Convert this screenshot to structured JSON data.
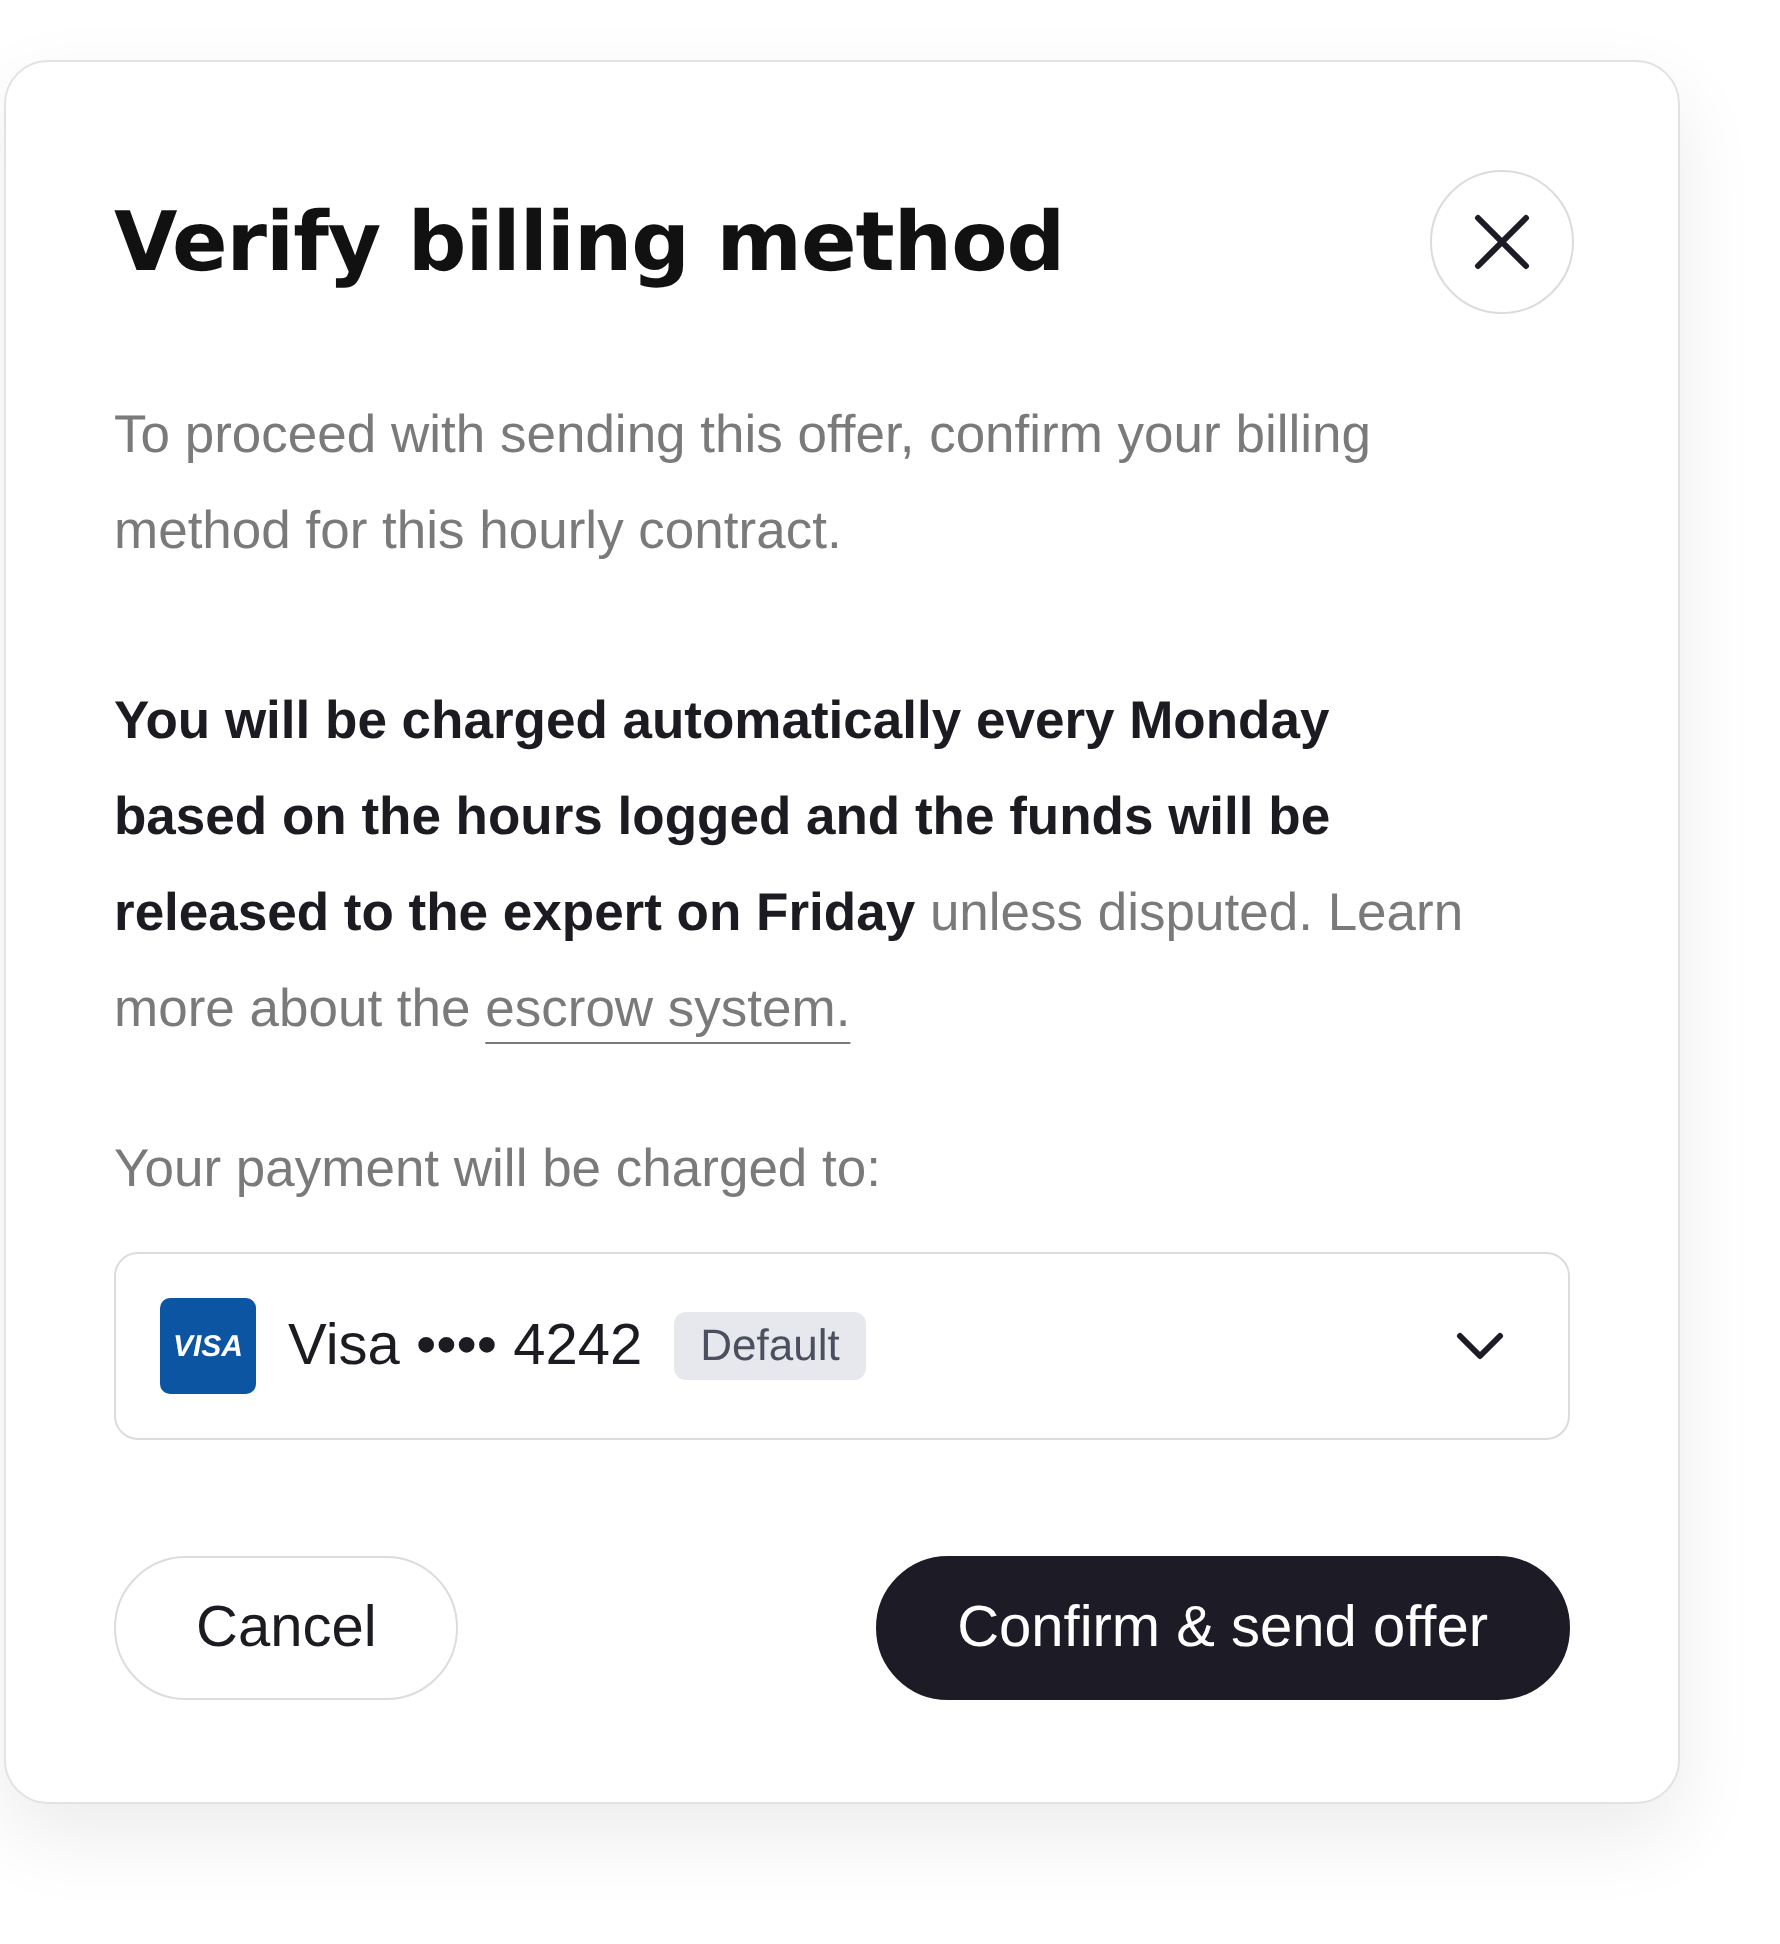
{
  "dialog": {
    "title": "Verify billing method",
    "intro": "To proceed with sending this offer, confirm your billing method for this hourly contract.",
    "notice": {
      "text": "**You will be charged automatically every Monday based on the hours logged and the funds will be released to the expert on Friday** unless disputed. Learn more about the ",
      "link": "escrow system."
    },
    "payment_label": "Your payment will be charged to:",
    "payment_method": {
      "logo": "VISA",
      "label": "Visa •••• 4242",
      "badge": "Default"
    },
    "buttons": [
      {
        "label": "Cancel",
        "kind": "secondary"
      },
      {
        "label": "Confirm & send offer",
        "kind": "primary"
      }
    ]
  }
}
